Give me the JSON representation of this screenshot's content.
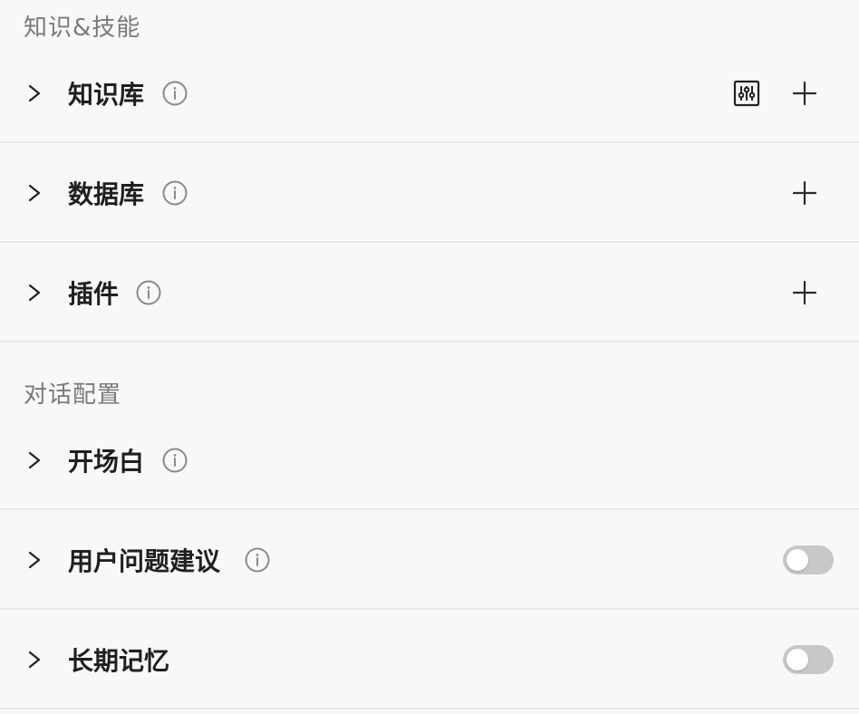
{
  "sections": {
    "knowledge_title": "知识&技能",
    "dialog_title": "对话配置"
  },
  "rows": {
    "knowledge": {
      "label": "知识库"
    },
    "database": {
      "label": "数据库"
    },
    "plugins": {
      "label": "插件"
    },
    "opening": {
      "label": "开场白"
    },
    "suggestions": {
      "label": "用户问题建议",
      "toggle_on": false
    },
    "memory": {
      "label": "长期记忆",
      "toggle_on": false
    }
  },
  "icons": {
    "chevron": "chevron-right-icon",
    "info": "info-icon",
    "add": "plus-icon",
    "settings": "sliders-icon"
  },
  "colors": {
    "background": "#f7f8f8",
    "divider": "#e6e7e8",
    "section_title": "#7a7a7a",
    "toggle_off": "#c7c8ca"
  }
}
